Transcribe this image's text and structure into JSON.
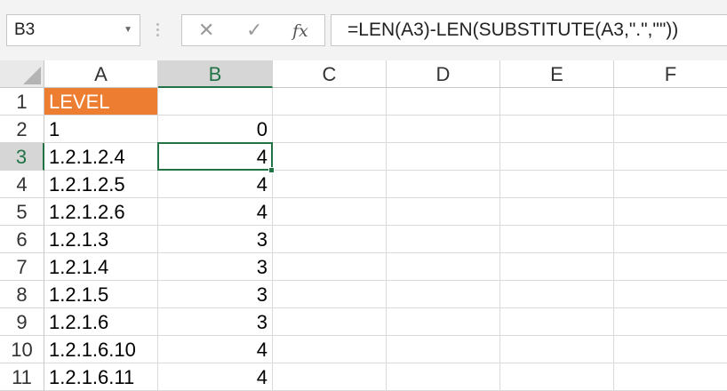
{
  "name_box": {
    "value": "B3"
  },
  "formula_bar": {
    "cancel_symbol": "✕",
    "enter_symbol": "✓",
    "fx_label": "fx",
    "formula": "=LEN(A3)-LEN(SUBSTITUTE(A3,\".\",\"\"))"
  },
  "columns": [
    "A",
    "B",
    "C",
    "D",
    "E",
    "F"
  ],
  "selected_column": "B",
  "selected_row": "3",
  "rows": [
    {
      "num": "1",
      "a": "LEVEL",
      "b": ""
    },
    {
      "num": "2",
      "a": "1",
      "b": "0"
    },
    {
      "num": "3",
      "a": "1.2.1.2.4",
      "b": "4"
    },
    {
      "num": "4",
      "a": "1.2.1.2.5",
      "b": "4"
    },
    {
      "num": "5",
      "a": "1.2.1.2.6",
      "b": "4"
    },
    {
      "num": "6",
      "a": "1.2.1.3",
      "b": "3"
    },
    {
      "num": "7",
      "a": "1.2.1.4",
      "b": "3"
    },
    {
      "num": "8",
      "a": "1.2.1.5",
      "b": "3"
    },
    {
      "num": "9",
      "a": "1.2.1.6",
      "b": "3"
    },
    {
      "num": "10",
      "a": "1.2.1.6.10",
      "b": "4"
    },
    {
      "num": "11",
      "a": "1.2.1.6.11",
      "b": "4"
    }
  ],
  "colors": {
    "accent": "#217346",
    "header_fill": "#ed7d31"
  }
}
